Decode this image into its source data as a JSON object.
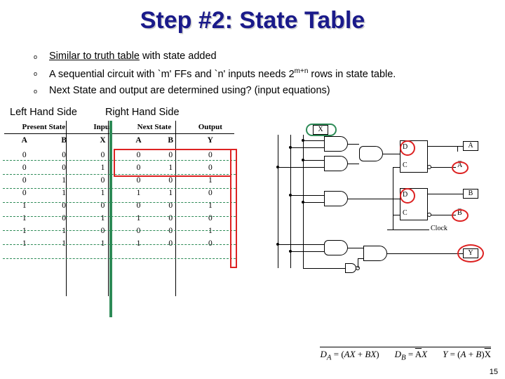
{
  "title": "Step #2: State Table",
  "bullets": [
    {
      "html": "<u>Similar to truth table</u> with state added"
    },
    {
      "html": "A sequential circuit with `m' FFs and `n' inputs needs 2<sup>m+n</sup> rows in state table."
    },
    {
      "html": "Next State and output are determined using? (input equations)"
    }
  ],
  "side_labels": {
    "left": "Left Hand Side",
    "right": "Right Hand Side"
  },
  "table": {
    "groups": [
      "Present State",
      "Input",
      "Next State",
      "Output"
    ],
    "cols": [
      "A",
      "B",
      "X",
      "A",
      "B",
      "Y"
    ],
    "rows": [
      [
        0,
        0,
        0,
        0,
        0,
        0
      ],
      [
        0,
        0,
        1,
        0,
        1,
        0
      ],
      [
        0,
        1,
        0,
        0,
        0,
        1
      ],
      [
        0,
        1,
        1,
        1,
        1,
        0
      ],
      [
        1,
        0,
        0,
        0,
        0,
        1
      ],
      [
        1,
        0,
        1,
        1,
        0,
        0
      ],
      [
        1,
        1,
        0,
        0,
        0,
        1
      ],
      [
        1,
        1,
        1,
        1,
        0,
        0
      ]
    ]
  },
  "circuit_labels": {
    "X": "X",
    "A": "A",
    "Ab": "A̅",
    "B": "B",
    "Bb": "B̅",
    "Y": "Y",
    "D": "D",
    "C": "C",
    "Clock": "Clock"
  },
  "equations": {
    "DA": "D_A = (AX + BX)",
    "DB": "D_B = A̅X",
    "Y": "Y = (A + B)X̅"
  },
  "page": "15"
}
